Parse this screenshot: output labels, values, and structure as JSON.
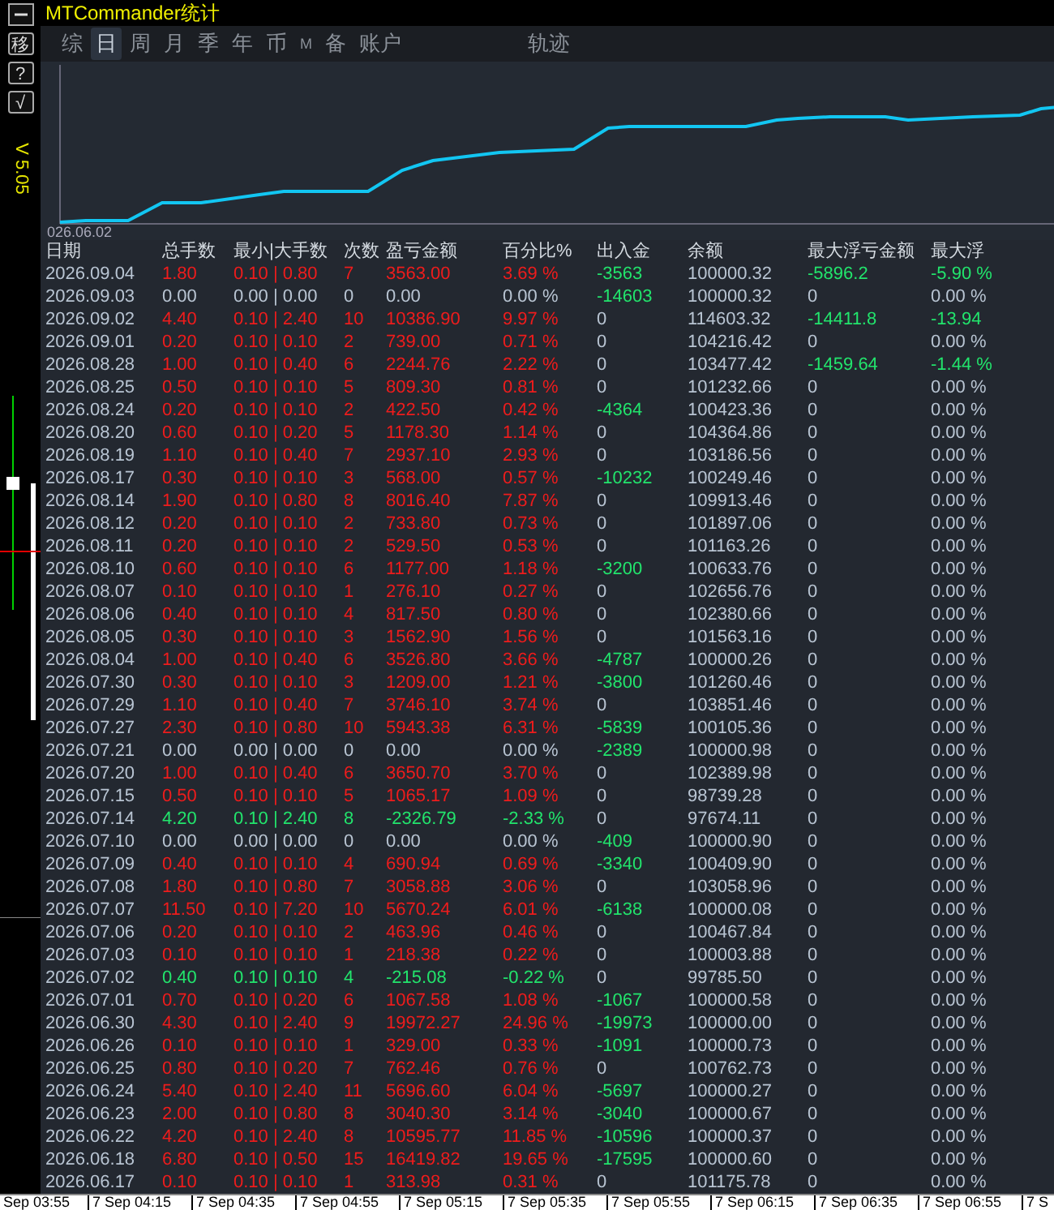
{
  "window": {
    "title": "MTCommander统计"
  },
  "toolbar": {
    "buttons": [
      "移",
      "?",
      "√"
    ],
    "version": "V 5.05"
  },
  "tabs": [
    {
      "label": "综",
      "selected": false
    },
    {
      "label": "日",
      "selected": true
    },
    {
      "label": "周",
      "selected": false
    },
    {
      "label": "月",
      "selected": false
    },
    {
      "label": "季",
      "selected": false
    },
    {
      "label": "年",
      "selected": false
    },
    {
      "label": "币",
      "selected": false
    },
    {
      "label": "M",
      "selected": false
    },
    {
      "label": "备",
      "selected": false
    },
    {
      "label": "账户",
      "selected": false
    }
  ],
  "track_tab": {
    "label": "轨迹",
    "selected": false
  },
  "chart": {
    "start_label": "026.06.02"
  },
  "table": {
    "columns": [
      "日期",
      "总手数",
      "最小|大手数",
      "次数",
      "盈亏金额",
      "百分比%",
      "出入金",
      "余额",
      "最大浮亏金额",
      "最大浮"
    ],
    "rows": [
      {
        "date": "2026.09.04",
        "lots": "1.80",
        "min_max": "0.10 | 0.80",
        "trades": "7",
        "pnl": "3563.00",
        "pct": "3.69 %",
        "cash": "-3563",
        "balance": "100000.32",
        "max_float": "-5896.2",
        "max_float_pct": "-5.90 %",
        "kind": "profit",
        "cash_moved": true,
        "floating": true
      },
      {
        "date": "2026.09.03",
        "lots": "0.00",
        "min_max": "0.00 | 0.00",
        "trades": "0",
        "pnl": "0.00",
        "pct": "0.00 %",
        "cash": "-14603",
        "balance": "100000.32",
        "max_float": "0",
        "max_float_pct": "0.00 %",
        "kind": "flat",
        "cash_moved": true,
        "floating": false
      },
      {
        "date": "2026.09.02",
        "lots": "4.40",
        "min_max": "0.10 | 2.40",
        "trades": "10",
        "pnl": "10386.90",
        "pct": "9.97 %",
        "cash": "0",
        "balance": "114603.32",
        "max_float": "-14411.8",
        "max_float_pct": "-13.94",
        "kind": "profit",
        "cash_moved": false,
        "floating": true
      },
      {
        "date": "2026.09.01",
        "lots": "0.20",
        "min_max": "0.10 | 0.10",
        "trades": "2",
        "pnl": "739.00",
        "pct": "0.71 %",
        "cash": "0",
        "balance": "104216.42",
        "max_float": "0",
        "max_float_pct": "0.00 %",
        "kind": "profit",
        "cash_moved": false,
        "floating": false
      },
      {
        "date": "2026.08.28",
        "lots": "1.00",
        "min_max": "0.10 | 0.40",
        "trades": "6",
        "pnl": "2244.76",
        "pct": "2.22 %",
        "cash": "0",
        "balance": "103477.42",
        "max_float": "-1459.64",
        "max_float_pct": "-1.44 %",
        "kind": "profit",
        "cash_moved": false,
        "floating": true
      },
      {
        "date": "2026.08.25",
        "lots": "0.50",
        "min_max": "0.10 | 0.10",
        "trades": "5",
        "pnl": "809.30",
        "pct": "0.81 %",
        "cash": "0",
        "balance": "101232.66",
        "max_float": "0",
        "max_float_pct": "0.00 %",
        "kind": "profit",
        "cash_moved": false,
        "floating": false
      },
      {
        "date": "2026.08.24",
        "lots": "0.20",
        "min_max": "0.10 | 0.10",
        "trades": "2",
        "pnl": "422.50",
        "pct": "0.42 %",
        "cash": "-4364",
        "balance": "100423.36",
        "max_float": "0",
        "max_float_pct": "0.00 %",
        "kind": "profit",
        "cash_moved": true,
        "floating": false
      },
      {
        "date": "2026.08.20",
        "lots": "0.60",
        "min_max": "0.10 | 0.20",
        "trades": "5",
        "pnl": "1178.30",
        "pct": "1.14 %",
        "cash": "0",
        "balance": "104364.86",
        "max_float": "0",
        "max_float_pct": "0.00 %",
        "kind": "profit",
        "cash_moved": false,
        "floating": false
      },
      {
        "date": "2026.08.19",
        "lots": "1.10",
        "min_max": "0.10 | 0.40",
        "trades": "7",
        "pnl": "2937.10",
        "pct": "2.93 %",
        "cash": "0",
        "balance": "103186.56",
        "max_float": "0",
        "max_float_pct": "0.00 %",
        "kind": "profit",
        "cash_moved": false,
        "floating": false
      },
      {
        "date": "2026.08.17",
        "lots": "0.30",
        "min_max": "0.10 | 0.10",
        "trades": "3",
        "pnl": "568.00",
        "pct": "0.57 %",
        "cash": "-10232",
        "balance": "100249.46",
        "max_float": "0",
        "max_float_pct": "0.00 %",
        "kind": "profit",
        "cash_moved": true,
        "floating": false
      },
      {
        "date": "2026.08.14",
        "lots": "1.90",
        "min_max": "0.10 | 0.80",
        "trades": "8",
        "pnl": "8016.40",
        "pct": "7.87 %",
        "cash": "0",
        "balance": "109913.46",
        "max_float": "0",
        "max_float_pct": "0.00 %",
        "kind": "profit",
        "cash_moved": false,
        "floating": false
      },
      {
        "date": "2026.08.12",
        "lots": "0.20",
        "min_max": "0.10 | 0.10",
        "trades": "2",
        "pnl": "733.80",
        "pct": "0.73 %",
        "cash": "0",
        "balance": "101897.06",
        "max_float": "0",
        "max_float_pct": "0.00 %",
        "kind": "profit",
        "cash_moved": false,
        "floating": false
      },
      {
        "date": "2026.08.11",
        "lots": "0.20",
        "min_max": "0.10 | 0.10",
        "trades": "2",
        "pnl": "529.50",
        "pct": "0.53 %",
        "cash": "0",
        "balance": "101163.26",
        "max_float": "0",
        "max_float_pct": "0.00 %",
        "kind": "profit",
        "cash_moved": false,
        "floating": false
      },
      {
        "date": "2026.08.10",
        "lots": "0.60",
        "min_max": "0.10 | 0.10",
        "trades": "6",
        "pnl": "1177.00",
        "pct": "1.18 %",
        "cash": "-3200",
        "balance": "100633.76",
        "max_float": "0",
        "max_float_pct": "0.00 %",
        "kind": "profit",
        "cash_moved": true,
        "floating": false
      },
      {
        "date": "2026.08.07",
        "lots": "0.10",
        "min_max": "0.10 | 0.10",
        "trades": "1",
        "pnl": "276.10",
        "pct": "0.27 %",
        "cash": "0",
        "balance": "102656.76",
        "max_float": "0",
        "max_float_pct": "0.00 %",
        "kind": "profit",
        "cash_moved": false,
        "floating": false
      },
      {
        "date": "2026.08.06",
        "lots": "0.40",
        "min_max": "0.10 | 0.10",
        "trades": "4",
        "pnl": "817.50",
        "pct": "0.80 %",
        "cash": "0",
        "balance": "102380.66",
        "max_float": "0",
        "max_float_pct": "0.00 %",
        "kind": "profit",
        "cash_moved": false,
        "floating": false
      },
      {
        "date": "2026.08.05",
        "lots": "0.30",
        "min_max": "0.10 | 0.10",
        "trades": "3",
        "pnl": "1562.90",
        "pct": "1.56 %",
        "cash": "0",
        "balance": "101563.16",
        "max_float": "0",
        "max_float_pct": "0.00 %",
        "kind": "profit",
        "cash_moved": false,
        "floating": false
      },
      {
        "date": "2026.08.04",
        "lots": "1.00",
        "min_max": "0.10 | 0.40",
        "trades": "6",
        "pnl": "3526.80",
        "pct": "3.66 %",
        "cash": "-4787",
        "balance": "100000.26",
        "max_float": "0",
        "max_float_pct": "0.00 %",
        "kind": "profit",
        "cash_moved": true,
        "floating": false
      },
      {
        "date": "2026.07.30",
        "lots": "0.30",
        "min_max": "0.10 | 0.10",
        "trades": "3",
        "pnl": "1209.00",
        "pct": "1.21 %",
        "cash": "-3800",
        "balance": "101260.46",
        "max_float": "0",
        "max_float_pct": "0.00 %",
        "kind": "profit",
        "cash_moved": true,
        "floating": false
      },
      {
        "date": "2026.07.29",
        "lots": "1.10",
        "min_max": "0.10 | 0.40",
        "trades": "7",
        "pnl": "3746.10",
        "pct": "3.74 %",
        "cash": "0",
        "balance": "103851.46",
        "max_float": "0",
        "max_float_pct": "0.00 %",
        "kind": "profit",
        "cash_moved": false,
        "floating": false
      },
      {
        "date": "2026.07.27",
        "lots": "2.30",
        "min_max": "0.10 | 0.80",
        "trades": "10",
        "pnl": "5943.38",
        "pct": "6.31 %",
        "cash": "-5839",
        "balance": "100105.36",
        "max_float": "0",
        "max_float_pct": "0.00 %",
        "kind": "profit",
        "cash_moved": true,
        "floating": false
      },
      {
        "date": "2026.07.21",
        "lots": "0.00",
        "min_max": "0.00 | 0.00",
        "trades": "0",
        "pnl": "0.00",
        "pct": "0.00 %",
        "cash": "-2389",
        "balance": "100000.98",
        "max_float": "0",
        "max_float_pct": "0.00 %",
        "kind": "flat",
        "cash_moved": true,
        "floating": false
      },
      {
        "date": "2026.07.20",
        "lots": "1.00",
        "min_max": "0.10 | 0.40",
        "trades": "6",
        "pnl": "3650.70",
        "pct": "3.70 %",
        "cash": "0",
        "balance": "102389.98",
        "max_float": "0",
        "max_float_pct": "0.00 %",
        "kind": "profit",
        "cash_moved": false,
        "floating": false
      },
      {
        "date": "2026.07.15",
        "lots": "0.50",
        "min_max": "0.10 | 0.10",
        "trades": "5",
        "pnl": "1065.17",
        "pct": "1.09 %",
        "cash": "0",
        "balance": "98739.28",
        "max_float": "0",
        "max_float_pct": "0.00 %",
        "kind": "profit",
        "cash_moved": false,
        "floating": false
      },
      {
        "date": "2026.07.14",
        "lots": "4.20",
        "min_max": "0.10 | 2.40",
        "trades": "8",
        "pnl": "-2326.79",
        "pct": "-2.33 %",
        "cash": "0",
        "balance": "97674.11",
        "max_float": "0",
        "max_float_pct": "0.00 %",
        "kind": "loss",
        "cash_moved": false,
        "floating": false
      },
      {
        "date": "2026.07.10",
        "lots": "0.00",
        "min_max": "0.00 | 0.00",
        "trades": "0",
        "pnl": "0.00",
        "pct": "0.00 %",
        "cash": "-409",
        "balance": "100000.90",
        "max_float": "0",
        "max_float_pct": "0.00 %",
        "kind": "flat",
        "cash_moved": true,
        "floating": false
      },
      {
        "date": "2026.07.09",
        "lots": "0.40",
        "min_max": "0.10 | 0.10",
        "trades": "4",
        "pnl": "690.94",
        "pct": "0.69 %",
        "cash": "-3340",
        "balance": "100409.90",
        "max_float": "0",
        "max_float_pct": "0.00 %",
        "kind": "profit",
        "cash_moved": true,
        "floating": false
      },
      {
        "date": "2026.07.08",
        "lots": "1.80",
        "min_max": "0.10 | 0.80",
        "trades": "7",
        "pnl": "3058.88",
        "pct": "3.06 %",
        "cash": "0",
        "balance": "103058.96",
        "max_float": "0",
        "max_float_pct": "0.00 %",
        "kind": "profit",
        "cash_moved": false,
        "floating": false
      },
      {
        "date": "2026.07.07",
        "lots": "11.50",
        "min_max": "0.10 | 7.20",
        "trades": "10",
        "pnl": "5670.24",
        "pct": "6.01 %",
        "cash": "-6138",
        "balance": "100000.08",
        "max_float": "0",
        "max_float_pct": "0.00 %",
        "kind": "profit",
        "cash_moved": true,
        "floating": false
      },
      {
        "date": "2026.07.06",
        "lots": "0.20",
        "min_max": "0.10 | 0.10",
        "trades": "2",
        "pnl": "463.96",
        "pct": "0.46 %",
        "cash": "0",
        "balance": "100467.84",
        "max_float": "0",
        "max_float_pct": "0.00 %",
        "kind": "profit",
        "cash_moved": false,
        "floating": false
      },
      {
        "date": "2026.07.03",
        "lots": "0.10",
        "min_max": "0.10 | 0.10",
        "trades": "1",
        "pnl": "218.38",
        "pct": "0.22 %",
        "cash": "0",
        "balance": "100003.88",
        "max_float": "0",
        "max_float_pct": "0.00 %",
        "kind": "profit",
        "cash_moved": false,
        "floating": false
      },
      {
        "date": "2026.07.02",
        "lots": "0.40",
        "min_max": "0.10 | 0.10",
        "trades": "4",
        "pnl": "-215.08",
        "pct": "-0.22 %",
        "cash": "0",
        "balance": "99785.50",
        "max_float": "0",
        "max_float_pct": "0.00 %",
        "kind": "loss",
        "cash_moved": false,
        "floating": false
      },
      {
        "date": "2026.07.01",
        "lots": "0.70",
        "min_max": "0.10 | 0.20",
        "trades": "6",
        "pnl": "1067.58",
        "pct": "1.08 %",
        "cash": "-1067",
        "balance": "100000.58",
        "max_float": "0",
        "max_float_pct": "0.00 %",
        "kind": "profit",
        "cash_moved": true,
        "floating": false
      },
      {
        "date": "2026.06.30",
        "lots": "4.30",
        "min_max": "0.10 | 2.40",
        "trades": "9",
        "pnl": "19972.27",
        "pct": "24.96 %",
        "cash": "-19973",
        "balance": "100000.00",
        "max_float": "0",
        "max_float_pct": "0.00 %",
        "kind": "profit",
        "cash_moved": true,
        "floating": false
      },
      {
        "date": "2026.06.26",
        "lots": "0.10",
        "min_max": "0.10 | 0.10",
        "trades": "1",
        "pnl": "329.00",
        "pct": "0.33 %",
        "cash": "-1091",
        "balance": "100000.73",
        "max_float": "0",
        "max_float_pct": "0.00 %",
        "kind": "profit",
        "cash_moved": true,
        "floating": false
      },
      {
        "date": "2026.06.25",
        "lots": "0.80",
        "min_max": "0.10 | 0.20",
        "trades": "7",
        "pnl": "762.46",
        "pct": "0.76 %",
        "cash": "0",
        "balance": "100762.73",
        "max_float": "0",
        "max_float_pct": "0.00 %",
        "kind": "profit",
        "cash_moved": false,
        "floating": false
      },
      {
        "date": "2026.06.24",
        "lots": "5.40",
        "min_max": "0.10 | 2.40",
        "trades": "11",
        "pnl": "5696.60",
        "pct": "6.04 %",
        "cash": "-5697",
        "balance": "100000.27",
        "max_float": "0",
        "max_float_pct": "0.00 %",
        "kind": "profit",
        "cash_moved": true,
        "floating": false
      },
      {
        "date": "2026.06.23",
        "lots": "2.00",
        "min_max": "0.10 | 0.80",
        "trades": "8",
        "pnl": "3040.30",
        "pct": "3.14 %",
        "cash": "-3040",
        "balance": "100000.67",
        "max_float": "0",
        "max_float_pct": "0.00 %",
        "kind": "profit",
        "cash_moved": true,
        "floating": false
      },
      {
        "date": "2026.06.22",
        "lots": "4.20",
        "min_max": "0.10 | 2.40",
        "trades": "8",
        "pnl": "10595.77",
        "pct": "11.85 %",
        "cash": "-10596",
        "balance": "100000.37",
        "max_float": "0",
        "max_float_pct": "0.00 %",
        "kind": "profit",
        "cash_moved": true,
        "floating": false
      },
      {
        "date": "2026.06.18",
        "lots": "6.80",
        "min_max": "0.10 | 0.50",
        "trades": "15",
        "pnl": "16419.82",
        "pct": "19.65 %",
        "cash": "-17595",
        "balance": "100000.60",
        "max_float": "0",
        "max_float_pct": "0.00 %",
        "kind": "profit",
        "cash_moved": true,
        "floating": false
      },
      {
        "date": "2026.06.17",
        "lots": "0.10",
        "min_max": "0.10 | 0.10",
        "trades": "1",
        "pnl": "313.98",
        "pct": "0.31 %",
        "cash": "0",
        "balance": "101175.78",
        "max_float": "0",
        "max_float_pct": "0.00 %",
        "kind": "profit",
        "cash_moved": false,
        "floating": false
      }
    ]
  },
  "time_axis": [
    "Sep 03:55",
    "7 Sep 04:15",
    "7 Sep 04:35",
    "7 Sep 04:55",
    "7 Sep 05:15",
    "7 Sep 05:35",
    "7 Sep 05:55",
    "7 Sep 06:15",
    "7 Sep 06:35",
    "7 Sep 06:55",
    "7 S"
  ]
}
